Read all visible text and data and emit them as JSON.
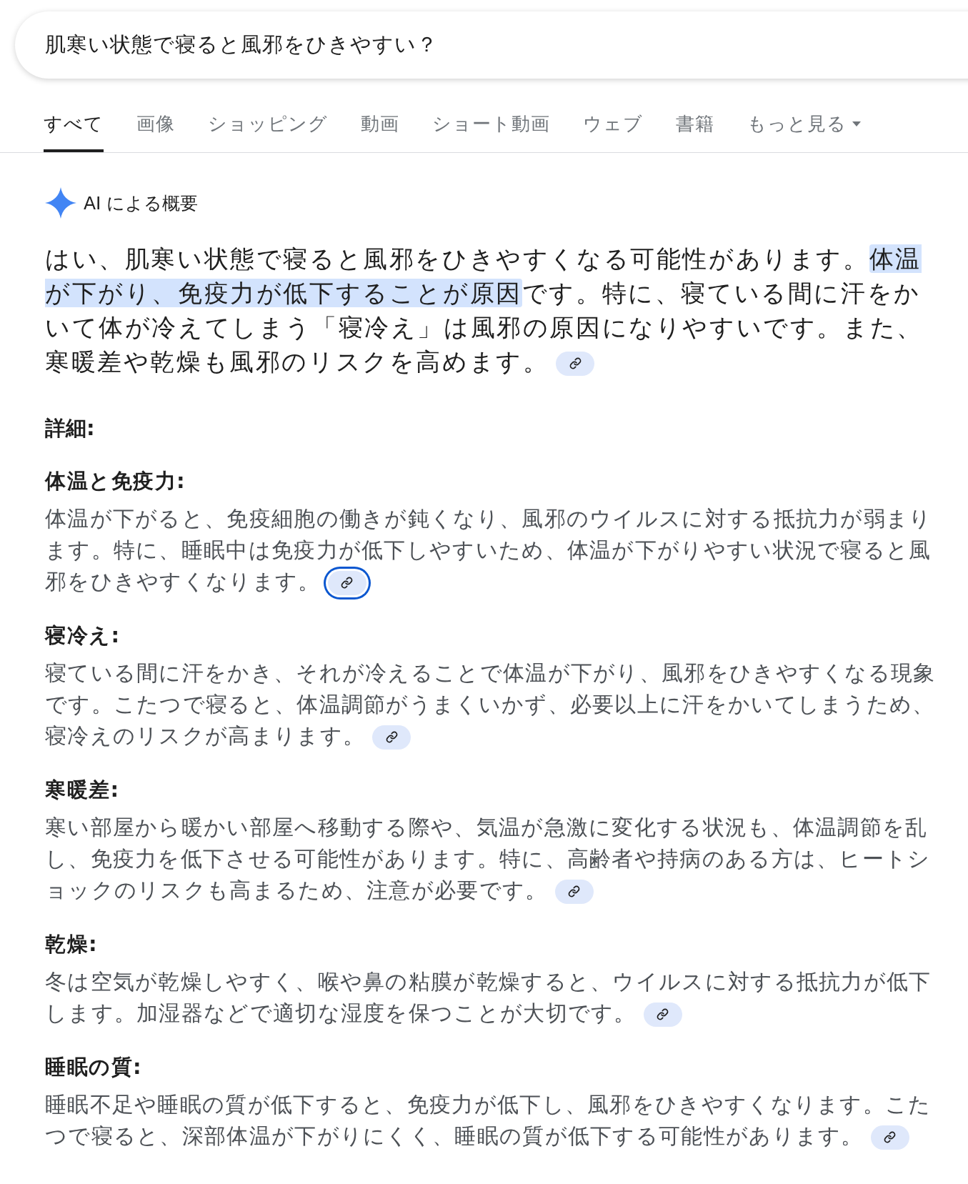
{
  "search": {
    "value": "肌寒い状態で寝ると風邪をひきやすい？"
  },
  "tabs": [
    {
      "label": "すべて",
      "selected": true,
      "kind": "plain"
    },
    {
      "label": "画像",
      "selected": false,
      "kind": "plain"
    },
    {
      "label": "ショッピング",
      "selected": false,
      "kind": "plain"
    },
    {
      "label": "動画",
      "selected": false,
      "kind": "plain"
    },
    {
      "label": "ショート動画",
      "selected": false,
      "kind": "plain"
    },
    {
      "label": "ウェブ",
      "selected": false,
      "kind": "plain"
    },
    {
      "label": "書籍",
      "selected": false,
      "kind": "plain"
    },
    {
      "label": "もっと見る",
      "selected": false,
      "kind": "menu"
    }
  ],
  "ai_overview": {
    "title": "AI による概要",
    "summary": {
      "segments": [
        {
          "text": "はい、肌寒い状態で寝ると風邪をひきやすくなる可能性があります。",
          "highlighted": false
        },
        {
          "text": "体温が下がり、免疫力が低下することが原因",
          "highlighted": true
        },
        {
          "text": "です。特に、寝ている間に汗をかいて体が冷えてしまう「寝冷え」は風邪の原因になりやすいです。また、寒暖差や乾燥も風邪のリスクを高めます。",
          "highlighted": false
        }
      ],
      "link_focused": false
    },
    "details_heading": "詳細:",
    "sections": [
      {
        "heading": "体温と免疫力:",
        "body": "体温が下がると、免疫細胞の働きが鈍くなり、風邪のウイルスに対する抵抗力が弱まります。特に、睡眠中は免疫力が低下しやすいため、体温が下がりやすい状況で寝ると風邪をひきやすくなります。",
        "link_focused": true
      },
      {
        "heading": "寝冷え:",
        "body": "寝ている間に汗をかき、それが冷えることで体温が下がり、風邪をひきやすくなる現象です。こたつで寝ると、体温調節がうまくいかず、必要以上に汗をかいてしまうため、寝冷えのリスクが高まります。",
        "link_focused": false
      },
      {
        "heading": "寒暖差:",
        "body": "寒い部屋から暖かい部屋へ移動する際や、気温が急激に変化する状況も、体温調節を乱し、免疫力を低下させる可能性があります。特に、高齢者や持病のある方は、ヒートショックのリスクも高まるため、注意が必要です。",
        "link_focused": false
      },
      {
        "heading": "乾燥:",
        "body": "冬は空気が乾燥しやすく、喉や鼻の粘膜が乾燥すると、ウイルスに対する抵抗力が低下します。加湿器などで適切な湿度を保つことが大切です。",
        "link_focused": false
      },
      {
        "heading": "睡眠の質:",
        "body": "睡眠不足や睡眠の質が低下すると、免疫力が低下し、風邪をひきやすくなります。こたつで寝ると、深部体温が下がりにくく、睡眠の質が低下する可能性があります。",
        "link_focused": false
      }
    ]
  }
}
